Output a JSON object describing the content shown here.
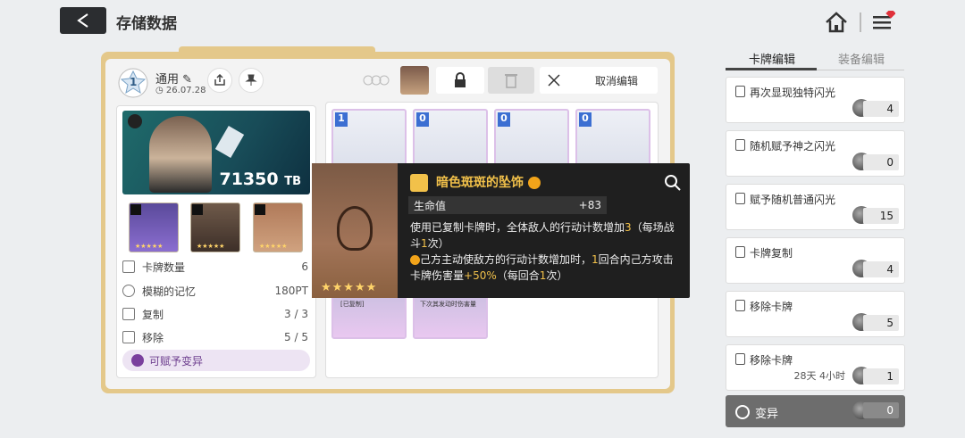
{
  "header": {
    "title": "存储数据"
  },
  "deck": {
    "name": "通用",
    "date": "26.07.28",
    "number": "1",
    "cancel_edit": "取消编辑",
    "banner_value": "71350",
    "banner_unit": "TB",
    "stats": [
      {
        "label": "卡牌数量",
        "value": "6"
      },
      {
        "label": "模糊的记忆",
        "value": "180PT"
      },
      {
        "label": "复制",
        "value": "3 / 3"
      },
      {
        "label": "移除",
        "value": "5 / 5"
      }
    ],
    "mutation_label": "可赋予变异",
    "equip_stars": "★★★★★",
    "card_numbers": [
      "1",
      "0",
      "0",
      "0"
    ],
    "card_tags": [
      "[已复制]",
      "下次其发动时伤害量"
    ]
  },
  "tooltip": {
    "title": "暗色斑斑的坠饰",
    "stat_label": "生命值",
    "stat_value": "+83",
    "desc1a": "使用已复制卡牌时，全体敌人的行动计数增加",
    "desc1b": "3",
    "desc1c": "（每场战斗",
    "desc1d": "1",
    "desc1e": "次）",
    "desc2a": "己方主动使敌方的行动计数增加时，",
    "desc2b": "1",
    "desc2c": "回合内己方攻击卡牌伤害量",
    "desc2d": "+50%",
    "desc2e": "（每回合",
    "desc2f": "1",
    "desc2g": "次）",
    "stars": "★★★★★"
  },
  "sidebar": {
    "tabs": [
      "卡牌编辑",
      "装备编辑"
    ],
    "items": [
      {
        "label": "再次显现独特闪光",
        "count": "4"
      },
      {
        "label": "随机赋予神之闪光",
        "count": "0"
      },
      {
        "label": "赋予随机普通闪光",
        "count": "15"
      },
      {
        "label": "卡牌复制",
        "count": "4"
      },
      {
        "label": "移除卡牌",
        "count": "5"
      },
      {
        "label": "移除卡牌",
        "count": "1",
        "timer": "28天 4小时"
      },
      {
        "label": "变异",
        "count": "0"
      }
    ]
  },
  "colors": {
    "accent_gold": "#e4c88a",
    "highlight": "#f2c14a",
    "badge_red": "#e0303a"
  }
}
